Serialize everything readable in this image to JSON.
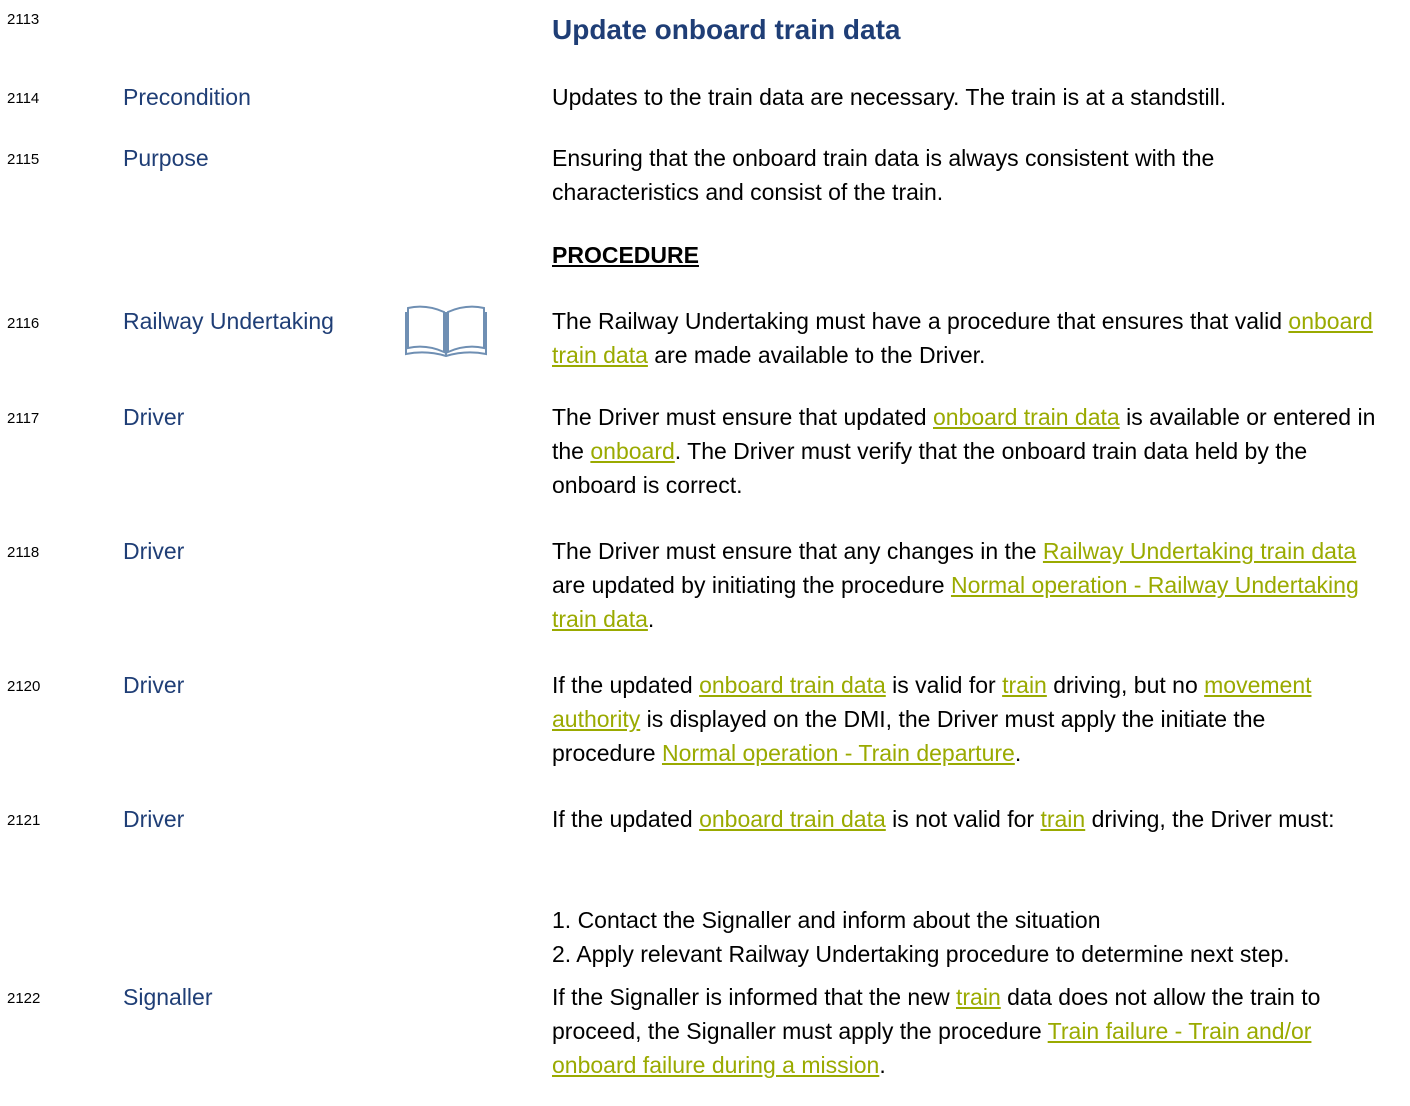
{
  "header": {
    "number": "2113",
    "title": "Update onboard train data"
  },
  "rows": [
    {
      "number": "2114",
      "role": "Precondition",
      "text": "Updates to the train data are necessary. The train is at a standstill."
    },
    {
      "number": "2115",
      "role": "Purpose",
      "text": "Ensuring that the onboard train data is always consistent with the characteristics and consist of the train."
    },
    {
      "heading": "PROCEDURE"
    },
    {
      "number": "2116",
      "role": "Railway Undertaking",
      "icon": "book-icon",
      "parts": [
        "The Railway Undertaking must have a procedure that ensures that valid ",
        "onboard train data",
        " are made available to the Driver."
      ]
    },
    {
      "number": "2117",
      "role": "Driver",
      "parts": [
        "The Driver must ensure that updated ",
        "onboard train data",
        " is available or entered in the ",
        "onboard",
        ". The Driver must verify that the onboard train data held by the onboard is correct."
      ]
    },
    {
      "number": "2118",
      "role": "Driver",
      "parts": [
        "The Driver must ensure that any changes in the ",
        "Railway Undertaking train data",
        " are updated by initiating the procedure ",
        "Normal operation - Railway Undertaking train data",
        "."
      ]
    },
    {
      "number": "2120",
      "role": "Driver",
      "parts": [
        "If the updated ",
        "onboard train data",
        " is valid for ",
        "train",
        " driving, but no ",
        "movement authority",
        " is displayed on the DMI, the Driver must apply the initiate the procedure ",
        "Normal operation - Train departure",
        "."
      ]
    },
    {
      "number": "2121",
      "role": "Driver",
      "parts": [
        "If the updated ",
        "onboard train data",
        " is not valid for ",
        "train",
        " driving, the Driver must:"
      ],
      "steps": [
        "1. Contact the Signaller and inform about the situation",
        "2. Apply relevant Railway Undertaking procedure to determine next step."
      ]
    },
    {
      "number": "2122",
      "role": "Signaller",
      "parts": [
        "If the Signaller is informed that the new ",
        "train",
        " data does not allow the train to proceed, the Signaller must apply the procedure ",
        "Train failure - Train and/or onboard failure during a mission",
        "."
      ]
    }
  ]
}
